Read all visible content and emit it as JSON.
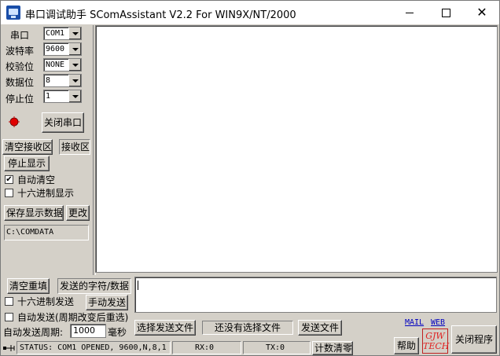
{
  "window": {
    "title": "串口调试助手 SComAssistant V2.2 For WIN9X/NT/2000"
  },
  "settings": {
    "port_label": "串口",
    "port_value": "COM1",
    "baud_label": "波特率",
    "baud_value": "9600",
    "parity_label": "校验位",
    "parity_value": "NONE",
    "databits_label": "数据位",
    "databits_value": "8",
    "stopbits_label": "停止位",
    "stopbits_value": "1",
    "close_port_label": "关闭串口",
    "led_color": "#e00000"
  },
  "receive": {
    "clear_label": "清空接收区",
    "area_label": "接收区",
    "stop_display_label": "停止显示",
    "auto_clear_label": "自动清空",
    "auto_clear_checked": "✔",
    "hex_display_label": "十六进制显示",
    "save_label": "保存显示数据",
    "change_label": "更改",
    "path": "C:\\COMDATA"
  },
  "send": {
    "clear_resend_label": "清空重填",
    "area_label": "发送的字符/数据",
    "hex_send_label": "十六进制发送",
    "manual_send_label": "手动发送",
    "auto_send_label": "自动发送(周期改变后重选)",
    "period_label": "自动发送周期:",
    "period_value": "1000",
    "period_unit": "毫秒",
    "select_file_label": "选择发送文件",
    "no_file_label": "还没有选择文件",
    "send_file_label": "发送文件"
  },
  "footer": {
    "mail_label": "MAIL",
    "web_label": "WEB",
    "help_label": "帮助",
    "logo_text_1": "GJW",
    "logo_text_2": "TECH",
    "close_program_label": "关闭程序"
  },
  "status": {
    "text": "STATUS: COM1 OPENED, 9600,N,8,1",
    "rx": "RX:0",
    "tx": "TX:0",
    "reset_count_label": "计数清零"
  }
}
